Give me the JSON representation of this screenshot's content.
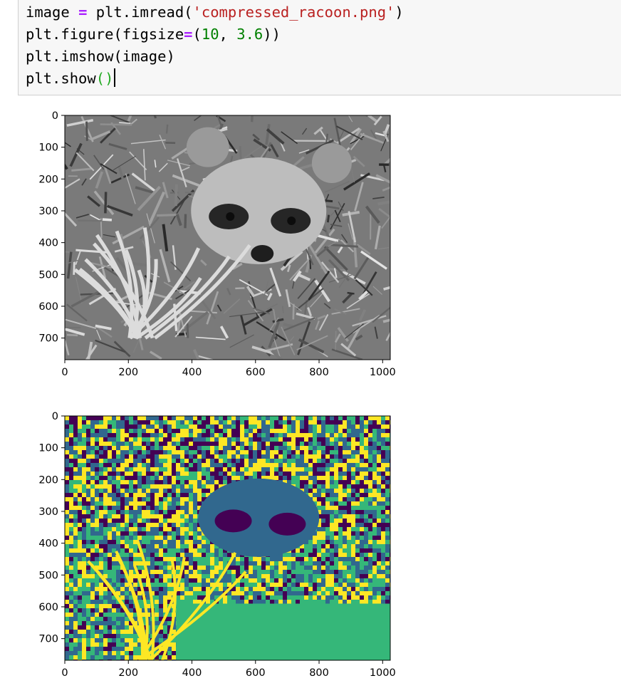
{
  "code_cell": {
    "line1": {
      "var": "image",
      "op": "=",
      "call": " plt.imread(",
      "str": "'compressed_racoon.png'",
      "close": ")"
    },
    "line2": {
      "call": "plt.figure(figsize",
      "op": "=",
      "open": "(",
      "num1": "10",
      "sep": ", ",
      "num2": "3.6",
      "close": "))"
    },
    "line3": {
      "call": "plt.imshow(image)"
    },
    "line4": {
      "call": "plt.show",
      "parens": "()"
    }
  },
  "chart_data": [
    {
      "type": "image",
      "colormap": "gray",
      "x_ticks": [
        "0",
        "200",
        "400",
        "600",
        "800",
        "1000"
      ],
      "y_ticks": [
        "0",
        "100",
        "200",
        "300",
        "400",
        "500",
        "600",
        "700"
      ],
      "x_tick_values": [
        0,
        200,
        400,
        600,
        800,
        1000
      ],
      "y_tick_values": [
        0,
        100,
        200,
        300,
        400,
        500,
        600,
        700
      ],
      "xlim": [
        0,
        1024
      ],
      "ylim": [
        768,
        0
      ]
    },
    {
      "type": "image",
      "colormap": "viridis",
      "colors": [
        "#440154",
        "#31688e",
        "#35b779",
        "#fde725"
      ],
      "x_ticks": [
        "0",
        "200",
        "400",
        "600",
        "800",
        "1000"
      ],
      "y_ticks": [
        "0",
        "100",
        "200",
        "300",
        "400",
        "500",
        "600",
        "700"
      ],
      "x_tick_values": [
        0,
        200,
        400,
        600,
        800,
        1000
      ],
      "y_tick_values": [
        0,
        100,
        200,
        300,
        400,
        500,
        600,
        700
      ],
      "xlim": [
        0,
        1024
      ],
      "ylim": [
        768,
        0
      ]
    }
  ]
}
